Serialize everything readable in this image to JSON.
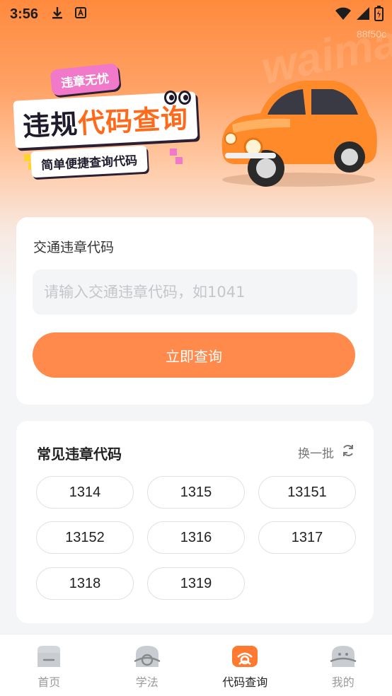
{
  "status_bar": {
    "time": "3:56",
    "watermark": "88f50c"
  },
  "banner": {
    "tag": "违章无忧",
    "title_part1": "违规",
    "title_part2": "代码查询",
    "subtitle": "简单便捷查询代码"
  },
  "query": {
    "label": "交通违章代码",
    "input_value": "",
    "placeholder": "请输入交通违章代码，如1041",
    "button_label": "立即查询"
  },
  "common_codes": {
    "title": "常见违章代码",
    "refresh_label": "换一批",
    "codes": [
      "1314",
      "1315",
      "13151",
      "13152",
      "1316",
      "1317",
      "1318",
      "1319"
    ]
  },
  "bottom_nav": {
    "items": [
      {
        "label": "首页",
        "icon": "home-icon",
        "active": false
      },
      {
        "label": "学法",
        "icon": "study-icon",
        "active": false
      },
      {
        "label": "代码查询",
        "icon": "code-query-icon",
        "active": true
      },
      {
        "label": "我的",
        "icon": "profile-icon",
        "active": false
      }
    ]
  },
  "colors": {
    "accent": "#ff8a4c",
    "header_gradient_top": "#ff8a3d",
    "tag_pink": "#f07ac9",
    "inactive_icon": "#c9ccd1"
  }
}
